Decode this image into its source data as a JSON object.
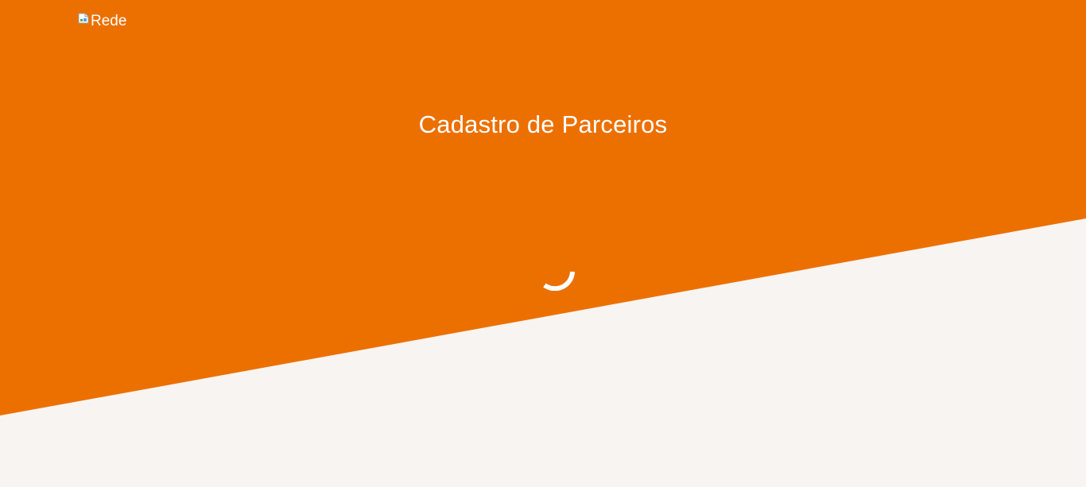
{
  "header": {
    "logo_alt": "Rede",
    "logo_icon": "broken-image-icon"
  },
  "main": {
    "title": "Cadastro de Parceiros",
    "loading_icon": "loading-spinner-icon"
  },
  "colors": {
    "brand_orange": "#EC7000",
    "background": "#F8F4F2",
    "text_on_brand": "#FFFFFF"
  }
}
